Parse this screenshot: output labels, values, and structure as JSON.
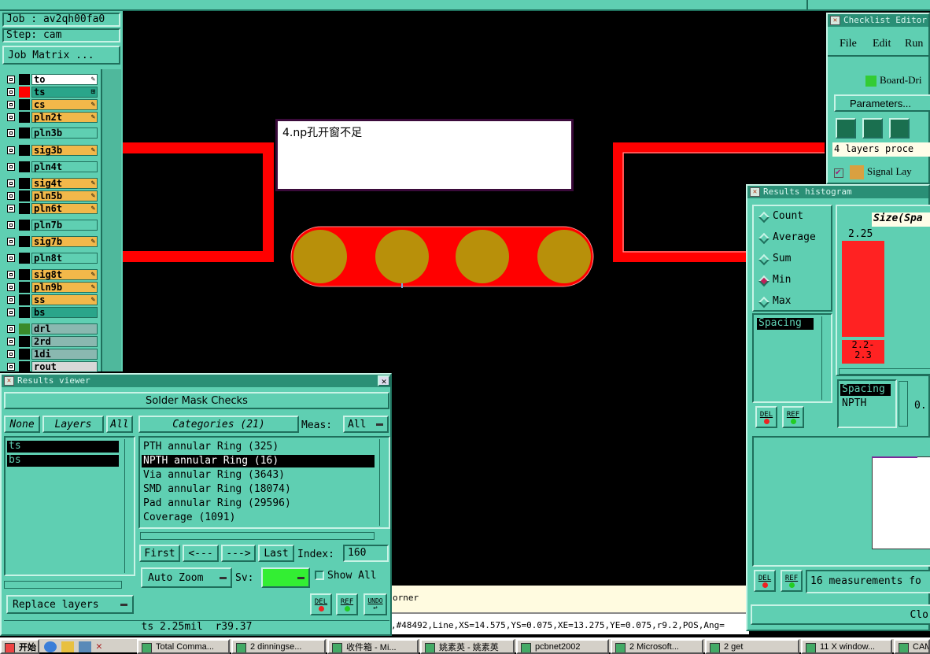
{
  "job": {
    "label": "Job : av2qh00fa0",
    "step": "Step: cam",
    "matrix_button": "Job Matrix ..."
  },
  "layers": [
    {
      "name": "to",
      "color": "#ffffff",
      "swatch": "#000000",
      "mark": "✎"
    },
    {
      "name": "ts",
      "color": "#2aa58a",
      "swatch": "#ff0000",
      "mark": "⊞"
    },
    {
      "name": "cs",
      "color": "#f2b84a",
      "swatch": "#000000",
      "mark": "✎"
    },
    {
      "name": "pln2t",
      "color": "#f2b84a",
      "swatch": "#000000",
      "mark": "✎"
    },
    {
      "name": "pln3b",
      "color": "#5fcfb2",
      "swatch": "#000000",
      "mark": ""
    },
    {
      "name": "sig3b",
      "color": "#f2b84a",
      "swatch": "#000000",
      "mark": "✎"
    },
    {
      "name": "pln4t",
      "color": "#5fcfb2",
      "swatch": "#000000",
      "mark": ""
    },
    {
      "name": "sig4t",
      "color": "#f2b84a",
      "swatch": "#000000",
      "mark": "✎"
    },
    {
      "name": "pln5b",
      "color": "#f2b84a",
      "swatch": "#000000",
      "mark": "✎"
    },
    {
      "name": "pln6t",
      "color": "#f2b84a",
      "swatch": "#000000",
      "mark": "✎"
    },
    {
      "name": "pln7b",
      "color": "#5fcfb2",
      "swatch": "#000000",
      "mark": ""
    },
    {
      "name": "sig7b",
      "color": "#f2b84a",
      "swatch": "#000000",
      "mark": "✎"
    },
    {
      "name": "pln8t",
      "color": "#5fcfb2",
      "swatch": "#000000",
      "mark": ""
    },
    {
      "name": "sig8t",
      "color": "#f2b84a",
      "swatch": "#000000",
      "mark": "✎"
    },
    {
      "name": "pln9b",
      "color": "#f2b84a",
      "swatch": "#000000",
      "mark": "✎"
    },
    {
      "name": "ss",
      "color": "#f2b84a",
      "swatch": "#000000",
      "mark": "✎"
    },
    {
      "name": "bs",
      "color": "#2aa58a",
      "swatch": "#000000",
      "mark": ""
    },
    {
      "name": "drl",
      "color": "#8ab8b0",
      "swatch": "#3a8a2a",
      "mark": ""
    },
    {
      "name": "2rd",
      "color": "#8ab8b0",
      "swatch": "#000000",
      "mark": ""
    },
    {
      "name": "1di",
      "color": "#8ab8b0",
      "swatch": "#000000",
      "mark": ""
    },
    {
      "name": "rout",
      "color": "#d8d8d8",
      "swatch": "#000000",
      "mark": ""
    }
  ],
  "canvas": {
    "note": "4.np孔开窗不足",
    "status_partial": "orner",
    "coords": ",#48492,Line,XS=14.575,YS=0.075,XE=13.275,YE=0.075,r9.2,POS,Ang="
  },
  "results_viewer": {
    "title": "Results viewer",
    "header": "Solder Mask Checks",
    "none_btn": "None",
    "layers_btn": "Layers",
    "all_btn": "All",
    "layer_list": [
      "ts",
      "bs"
    ],
    "categories_label": "Categories (21)",
    "meas_label": "Meas:",
    "meas_value": "All",
    "categories": [
      "PTH annular Ring (325)",
      "NPTH annular Ring (16)",
      "Via annular Ring (3643)",
      "SMD annular Ring (18074)",
      "Pad annular Ring (29596)",
      "Coverage (1091)"
    ],
    "selected_category": 1,
    "first": "First",
    "prev": "<---",
    "next": "--->",
    "last": "Last",
    "index_label": "Index:",
    "index_value": "160",
    "auto_zoom": "Auto Zoom",
    "sv_label": "Sv:",
    "show_all": "Show All",
    "replace_layers": "Replace layers",
    "del": "DEL",
    "ref": "REF",
    "undo": "UNDO",
    "status": "ts 2.25mil  r39.37"
  },
  "checklist": {
    "title": "Checklist Editor",
    "menu": [
      "File",
      "Edit",
      "Run"
    ],
    "board": "Board-Dri",
    "params": "Parameters...",
    "progress": "4 layers proce",
    "signal": "Signal Lay"
  },
  "histogram": {
    "title": "Results histogram",
    "options": [
      "Count",
      "Average",
      "Sum",
      "Min",
      "Max"
    ],
    "selected": "Min",
    "list_item": "Spacing",
    "size_label": "Size(Spa",
    "bar_value": "2.25",
    "bar_range": "2.2-\n2.3",
    "list2": [
      "Spacing",
      "NPTH"
    ],
    "partial_value": "0.",
    "del": "DEL",
    "ref": "REF",
    "measurements": "16 measurements fo",
    "close": "Clo"
  },
  "taskbar": {
    "start": "开始",
    "items": [
      "Total Comma...",
      "2 dinningse...",
      "收件箱 - Mi...",
      "姚素英 - 姚素英",
      "pcbnet2002",
      "2 Microsoft...",
      "2 get",
      "11 X window...",
      "CAM"
    ]
  }
}
